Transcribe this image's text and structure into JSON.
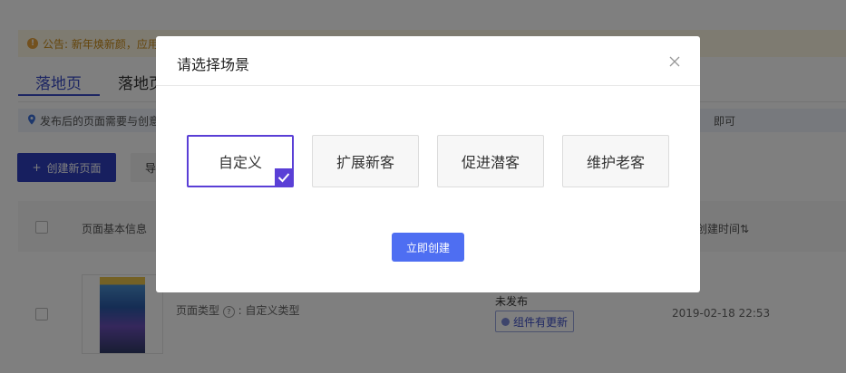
{
  "notice": {
    "text": "公告: 新年焕新颜，应用"
  },
  "tabs": [
    {
      "label": "落地页"
    },
    {
      "label": "落地页"
    }
  ],
  "tip": {
    "text": "发布后的页面需要与创意",
    "tail": "即可"
  },
  "toolbar": {
    "create_label": "创建新页面",
    "import_label": "导"
  },
  "table": {
    "headers": {
      "info": "页面基本信息",
      "time": "创建时间"
    },
    "row": {
      "page_type_label": "页面类型",
      "page_type_value": ": 自定义类型",
      "status": "未发布",
      "badge": "组件有更新",
      "date": "2019-02-18 22:53"
    }
  },
  "modal": {
    "title": "请选择场景",
    "scenes": [
      {
        "label": "自定义",
        "selected": true
      },
      {
        "label": "扩展新客",
        "selected": false
      },
      {
        "label": "促进潜客",
        "selected": false
      },
      {
        "label": "维护老客",
        "selected": false
      }
    ],
    "confirm_label": "立即创建"
  },
  "colors": {
    "primary": "#4e6ef2",
    "selected": "#5a3fd6",
    "nav": "#2f3fbf",
    "notice_text": "#c98a16"
  },
  "icons": {
    "close": "close-icon",
    "check": "check-icon",
    "plus": "plus-icon",
    "location": "location-pin-icon",
    "warning": "warning-icon",
    "sort": "sort-icon",
    "question": "question-icon"
  }
}
